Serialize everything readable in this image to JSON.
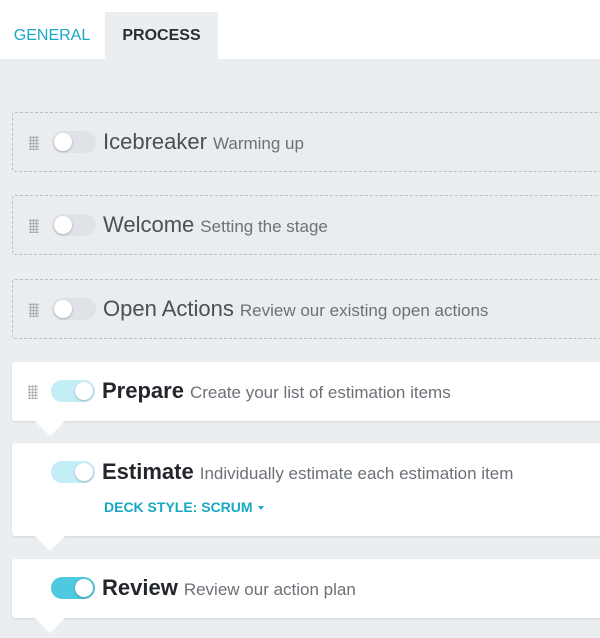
{
  "tabs": {
    "general": "GENERAL",
    "process": "PROCESS"
  },
  "steps": [
    {
      "title": "Icebreaker",
      "description": "Warming up",
      "enabled": false
    },
    {
      "title": "Welcome",
      "description": "Setting the stage",
      "enabled": false
    },
    {
      "title": "Open Actions",
      "description": "Review our existing open actions",
      "enabled": false
    },
    {
      "title": "Prepare",
      "description": "Create your list of estimation items",
      "enabled": true
    },
    {
      "title": "Estimate",
      "description": "Individually estimate each estimation item",
      "enabled": true,
      "deck_style": "DECK STYLE: SCRUM"
    },
    {
      "title": "Review",
      "description": "Review our action plan",
      "enabled": true
    }
  ],
  "colors": {
    "accent": "#17a8c4",
    "toggle_on": "#4fc9e0",
    "toggle_locked": "#c4eef6",
    "toggle_off": "#dfe2e6",
    "background": "#ebeef1"
  },
  "icons": {
    "drag_handle": "grip-dots-icon",
    "dropdown": "caret-down-icon"
  }
}
